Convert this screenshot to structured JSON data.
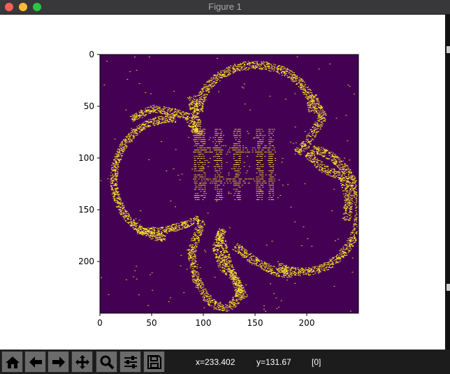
{
  "window": {
    "title": "Figure 1"
  },
  "chart_data": {
    "type": "heatmap",
    "title": "",
    "xlabel": "",
    "ylabel": "",
    "xlim": [
      0,
      250
    ],
    "ylim": [
      250,
      0
    ],
    "x_ticks": [
      "0",
      "50",
      "100",
      "150",
      "200"
    ],
    "y_ticks": [
      "0",
      "50",
      "100",
      "150",
      "200"
    ],
    "colormap": {
      "background": "#440154",
      "foreground": "#fde725"
    },
    "values": "binary 250x250 image: yellow speckled outline of a three-lobed clover/flower shape with a curled stem, on a purple field; dense block of text-like marks near center (x≈90–170, y≈70–140)"
  },
  "toolbar": {
    "buttons": [
      {
        "name": "home-icon"
      },
      {
        "name": "back-arrow-icon"
      },
      {
        "name": "forward-arrow-icon"
      },
      {
        "name": "pan-icon"
      },
      {
        "name": "zoom-icon"
      },
      {
        "name": "subplots-config-icon"
      },
      {
        "name": "save-icon"
      }
    ],
    "x_readout": "x=233.402",
    "y_readout": "y=131.67",
    "value_readout": "[0]"
  }
}
